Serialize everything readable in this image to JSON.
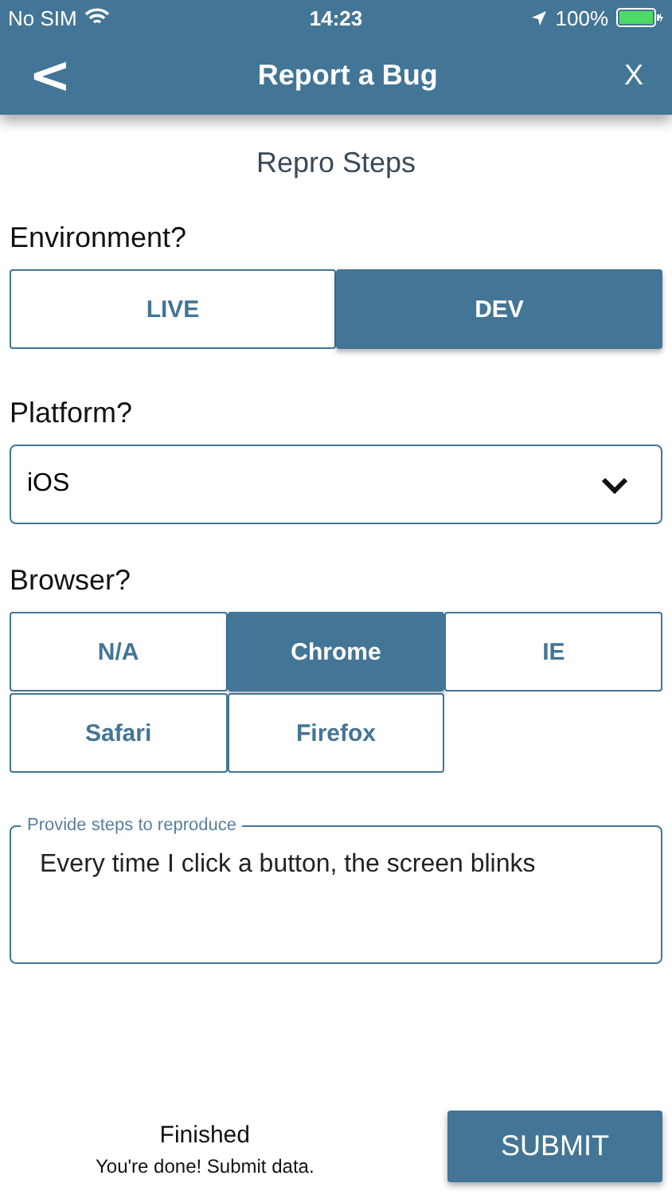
{
  "status_bar": {
    "carrier": "No SIM",
    "time": "14:23",
    "battery": "100%"
  },
  "nav": {
    "back": "<",
    "title": "Report a Bug",
    "close": "X"
  },
  "section_title": "Repro Steps",
  "environment": {
    "label": "Environment?",
    "options": [
      {
        "label": "LIVE",
        "selected": false
      },
      {
        "label": "DEV",
        "selected": true
      }
    ]
  },
  "platform": {
    "label": "Platform?",
    "value": "iOS"
  },
  "browser": {
    "label": "Browser?",
    "options": [
      {
        "label": "N/A",
        "selected": false
      },
      {
        "label": "Chrome",
        "selected": true
      },
      {
        "label": "IE",
        "selected": false
      },
      {
        "label": "Safari",
        "selected": false
      },
      {
        "label": "Firefox",
        "selected": false
      }
    ]
  },
  "steps": {
    "placeholder": "Provide steps to reproduce",
    "value": "Every time I click a button, the screen blinks"
  },
  "footer": {
    "title": "Finished",
    "subtitle": "You're done! Submit data.",
    "button": "SUBMIT"
  }
}
